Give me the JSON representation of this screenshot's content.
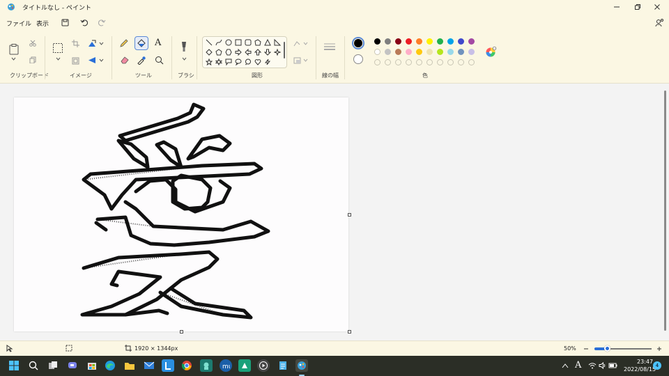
{
  "window": {
    "title": "タイトルなし - ペイント"
  },
  "menu": {
    "file": "ファイル",
    "view": "表示"
  },
  "ribbon": {
    "groups": {
      "clipboard": "クリップボード",
      "image": "イメージ",
      "tools": "ツール",
      "brush": "ブラシ",
      "shapes": "図形",
      "line_width": "線の幅",
      "colors": "色"
    },
    "text_tool_glyph": "A",
    "palette_row1": [
      "#000000",
      "#7f7f7f",
      "#880015",
      "#ed1c24",
      "#ff7f27",
      "#fff200",
      "#22b14c",
      "#00a2e8",
      "#3f48cc",
      "#a349a4"
    ],
    "palette_row2": [
      "#ffffff",
      "#c3c3c3",
      "#b97a57",
      "#ffaec9",
      "#ffc90e",
      "#efe4b0",
      "#b5e61d",
      "#99d9ea",
      "#7092be",
      "#c8bfe7"
    ],
    "primary_color": "#000000",
    "secondary_color": "#ffffff"
  },
  "status": {
    "canvas_size": "1920 × 1344px",
    "zoom": "50%"
  },
  "taskbar": {
    "time": "23:47",
    "date": "2022/08/15",
    "ime": "A",
    "notifications": "4"
  }
}
